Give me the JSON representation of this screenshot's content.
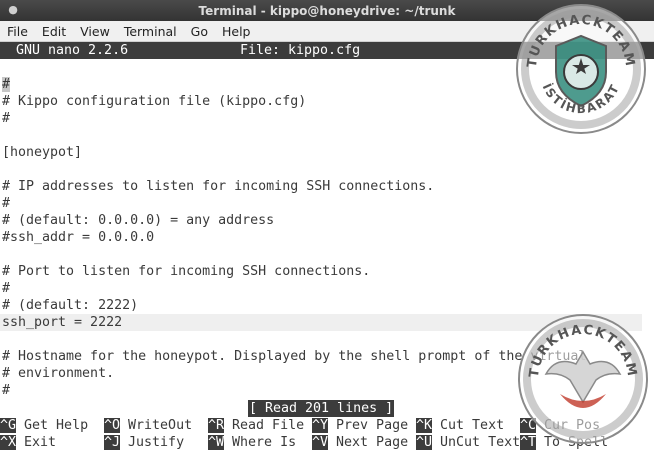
{
  "window": {
    "title": "Terminal - kippo@honeydrive: ~/trunk"
  },
  "menu": [
    "File",
    "Edit",
    "View",
    "Terminal",
    "Go",
    "Help"
  ],
  "nano": {
    "version": "GNU nano 2.2.6",
    "file": "File: kippo.cfg"
  },
  "buffer": [
    "#",
    "# Kippo configuration file (kippo.cfg)",
    "#",
    "",
    "[honeypot]",
    "",
    "# IP addresses to listen for incoming SSH connections.",
    "#",
    "# (default: 0.0.0.0) = any address",
    "#ssh_addr = 0.0.0.0",
    "",
    "# Port to listen for incoming SSH connections.",
    "#",
    "# (default: 2222)",
    "ssh_port = 2222",
    "",
    "# Hostname for the honeypot. Displayed by the shell prompt of the virtual",
    "# environment.",
    "#"
  ],
  "status": "[ Read 201 lines ]",
  "shortcuts": {
    "row1": [
      {
        "key": "^G",
        "label": "Get Help"
      },
      {
        "key": "^O",
        "label": "WriteOut"
      },
      {
        "key": "^R",
        "label": "Read File"
      },
      {
        "key": "^Y",
        "label": "Prev Page"
      },
      {
        "key": "^K",
        "label": "Cut Text"
      },
      {
        "key": "^C",
        "label": "Cur Pos"
      }
    ],
    "row2": [
      {
        "key": "^X",
        "label": "Exit"
      },
      {
        "key": "^J",
        "label": "Justify"
      },
      {
        "key": "^W",
        "label": "Where Is"
      },
      {
        "key": "^V",
        "label": "Next Page"
      },
      {
        "key": "^U",
        "label": "UnCut Text"
      },
      {
        "key": "^T",
        "label": "To Spell"
      }
    ]
  },
  "watermark": {
    "brand": "TURKHACKTEAM",
    "sub": "İSTİHBARAT"
  },
  "colors": {
    "titlebar": "#3a3a3a",
    "header_bg": "#3c3c3c",
    "current_line": "#efefef",
    "emblem_green": "#2f8a7a"
  }
}
